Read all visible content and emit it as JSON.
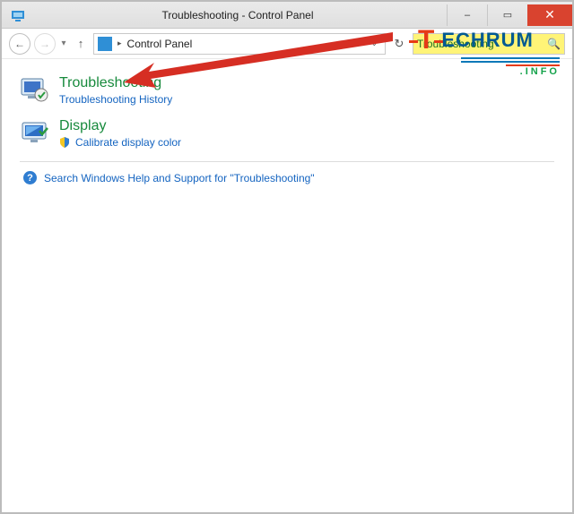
{
  "window": {
    "title": "Troubleshooting - Control Panel",
    "minimize_label": "–",
    "maximize_label": "▭",
    "close_label": "✕"
  },
  "nav": {
    "back_glyph": "←",
    "forward_glyph": "→",
    "dropdown_glyph": "▾",
    "up_glyph": "↑",
    "crumb_sep": "▸",
    "crumb_label": "Control Panel",
    "address_dd": "⌄",
    "refresh_glyph": "↻"
  },
  "search": {
    "value": "Troubleshooting",
    "icon_glyph": "🔍"
  },
  "results": [
    {
      "key": "troubleshooting",
      "heading": "Troubleshooting",
      "sub_label": "Troubleshooting History",
      "show_shield": false
    },
    {
      "key": "display",
      "heading": "Display",
      "sub_label": "Calibrate display color",
      "show_shield": true
    }
  ],
  "help": {
    "label": "Search Windows Help and Support for \"Troubleshooting\"",
    "q": "?"
  },
  "watermark": {
    "brand_left": "T",
    "brand_right": "ECHRUM",
    "sub": ".INFO"
  }
}
